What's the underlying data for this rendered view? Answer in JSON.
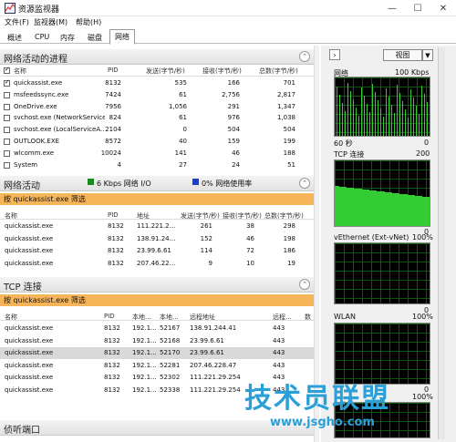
{
  "window": {
    "title": "资源监视器"
  },
  "menu": [
    "文件(F)",
    "监视器(M)",
    "帮助(H)"
  ],
  "tabs": [
    "概述",
    "CPU",
    "内存",
    "磁盘",
    "网络"
  ],
  "active_tab": "网络",
  "processes": {
    "title": "网络活动的进程",
    "headers": [
      "名称",
      "PID",
      "发送(字节/秒)",
      "接收(字节/秒)",
      "总数(字节/秒)"
    ],
    "rows": [
      {
        "checked": true,
        "name": "quickassist.exe",
        "pid": "8132",
        "send": "535",
        "recv": "166",
        "total": "701"
      },
      {
        "checked": false,
        "name": "msfeedssync.exe",
        "pid": "7424",
        "send": "61",
        "recv": "2,756",
        "total": "2,817"
      },
      {
        "checked": false,
        "name": "OneDrive.exe",
        "pid": "7956",
        "send": "1,056",
        "recv": "291",
        "total": "1,347"
      },
      {
        "checked": false,
        "name": "svchost.exe (NetworkService)",
        "pid": "824",
        "send": "61",
        "recv": "976",
        "total": "1,038"
      },
      {
        "checked": false,
        "name": "svchost.exe (LocalServiceA...",
        "pid": "2104",
        "send": "0",
        "recv": "504",
        "total": "504"
      },
      {
        "checked": false,
        "name": "OUTLOOK.EXE",
        "pid": "8572",
        "send": "40",
        "recv": "159",
        "total": "199"
      },
      {
        "checked": false,
        "name": "wlcomm.exe",
        "pid": "10024",
        "send": "141",
        "recv": "46",
        "total": "188"
      },
      {
        "checked": false,
        "name": "System",
        "pid": "4",
        "send": "27",
        "recv": "24",
        "total": "51"
      }
    ]
  },
  "network_activity": {
    "title": "网络活动",
    "io": "6 Kbps 网络 I/O",
    "usage": "0% 网络使用率",
    "io_color": "#1a8a1a",
    "usage_color": "#1a3fd0",
    "filter": "按 quickassist.exe 筛选",
    "headers": [
      "名称",
      "PID",
      "地址",
      "发送(字节/秒)",
      "接收(字节/秒)",
      "总数(字节/秒)"
    ],
    "rows": [
      {
        "name": "quickassist.exe",
        "pid": "8132",
        "addr": "111.221.2...",
        "send": "261",
        "recv": "38",
        "total": "298"
      },
      {
        "name": "quickassist.exe",
        "pid": "8132",
        "addr": "138.91.24...",
        "send": "152",
        "recv": "46",
        "total": "198"
      },
      {
        "name": "quickassist.exe",
        "pid": "8132",
        "addr": "23.99.6.61",
        "send": "114",
        "recv": "72",
        "total": "186"
      },
      {
        "name": "quickassist.exe",
        "pid": "8132",
        "addr": "207.46.22...",
        "send": "9",
        "recv": "10",
        "total": "19"
      }
    ]
  },
  "tcp": {
    "title": "TCP 连接",
    "filter": "按 quickassist.exe 筛选",
    "headers": [
      "名称",
      "PID",
      "本地...",
      "本地...",
      "远程地址",
      "远程...",
      "数"
    ],
    "rows": [
      {
        "name": "quickassist.exe",
        "pid": "8132",
        "laddr": "192.1...",
        "lport": "52167",
        "raddr": "138.91.244.41",
        "rport": "443",
        "selected": false
      },
      {
        "name": "quickassist.exe",
        "pid": "8132",
        "laddr": "192.1...",
        "lport": "52168",
        "raddr": "23.99.6.61",
        "rport": "443",
        "selected": false
      },
      {
        "name": "quickassist.exe",
        "pid": "8132",
        "laddr": "192.1...",
        "lport": "52170",
        "raddr": "23.99.6.61",
        "rport": "443",
        "selected": true
      },
      {
        "name": "quickassist.exe",
        "pid": "8132",
        "laddr": "192.1...",
        "lport": "52281",
        "raddr": "207.46.228.47",
        "rport": "443",
        "selected": false
      },
      {
        "name": "quickassist.exe",
        "pid": "8132",
        "laddr": "192.1...",
        "lport": "52302",
        "raddr": "111.221.29.254",
        "rport": "443",
        "selected": false
      },
      {
        "name": "quickassist.exe",
        "pid": "8132",
        "laddr": "192.1...",
        "lport": "52338",
        "raddr": "111.221.29.254",
        "rport": "443",
        "selected": false
      }
    ]
  },
  "listening": {
    "title": "侦听端口"
  },
  "right": {
    "view_button": "视图",
    "graphs": [
      {
        "label": "网络",
        "value": "100 Kbps",
        "bottom": "60 秒",
        "bottom_right": "0"
      },
      {
        "label": "TCP 连接",
        "value": "200",
        "bottom": "",
        "bottom_right": "0"
      },
      {
        "label": "vEthernet (Ext-vNet)",
        "value": "100%",
        "bottom": "",
        "bottom_right": "0"
      },
      {
        "label": "WLAN",
        "value": "100%",
        "bottom": "",
        "bottom_right": "0"
      },
      {
        "label": "",
        "value": "100%",
        "bottom": "",
        "bottom_right": ""
      }
    ]
  },
  "watermark": {
    "text": "技术员联盟",
    "url": "www.jsgho.com"
  }
}
